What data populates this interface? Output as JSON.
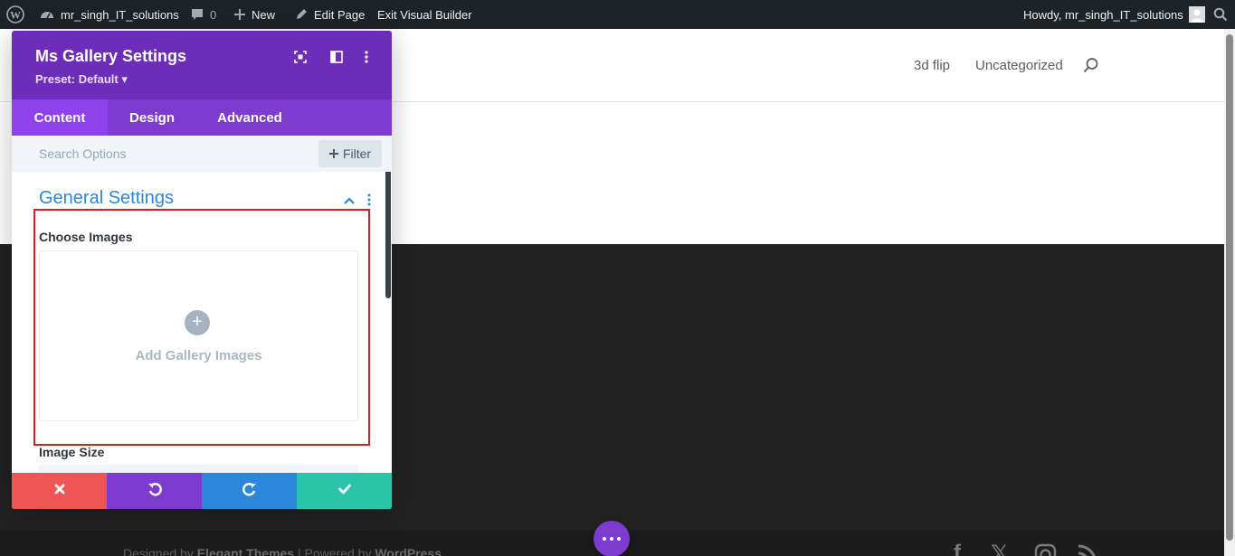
{
  "admin_bar": {
    "site_name": "mr_singh_IT_solutions",
    "comments_count": "0",
    "new_label": "New",
    "edit_page_label": "Edit Page",
    "exit_builder_label": "Exit Visual Builder",
    "howdy_label": "Howdy, mr_singh_IT_solutions"
  },
  "header": {
    "nav": [
      {
        "label": "3d flip"
      },
      {
        "label": "Uncategorized"
      }
    ]
  },
  "footer": {
    "designed_by_prefix": "Designed by",
    "designed_by_name": "Elegant Themes",
    "separator": " | ",
    "powered_by_prefix": "Powered by",
    "powered_by_name": "WordPress",
    "social_icons": [
      "facebook-icon",
      "x-icon",
      "instagram-icon",
      "rss-icon"
    ]
  },
  "modal": {
    "title": "Ms Gallery Settings",
    "preset": "Preset: Default ▾",
    "tabs": [
      {
        "label": "Content",
        "active": true
      },
      {
        "label": "Design",
        "active": false
      },
      {
        "label": "Advanced",
        "active": false
      }
    ],
    "search": {
      "placeholder": "Search Options",
      "value": ""
    },
    "filter_label": "Filter",
    "section_title": "General Settings",
    "fields": {
      "choose_images_label": "Choose Images",
      "add_gallery_text": "Add Gallery Images",
      "image_size_label": "Image Size"
    },
    "footer_buttons": [
      "discard-icon",
      "undo-icon",
      "redo-icon",
      "save-icon"
    ]
  },
  "colors": {
    "admin_bar_bg": "#1d2327",
    "modal_header": "#6c2eb9",
    "tab_bar": "#7e3bd0",
    "tab_active": "#8f42ec",
    "section_blue": "#2b87da",
    "discard_red": "#ef5555",
    "undo_purple": "#7e3bd0",
    "redo_blue": "#2b87da",
    "save_green": "#29c4a9",
    "highlight_red": "#dd1c1c",
    "dark_section": "#222222"
  }
}
